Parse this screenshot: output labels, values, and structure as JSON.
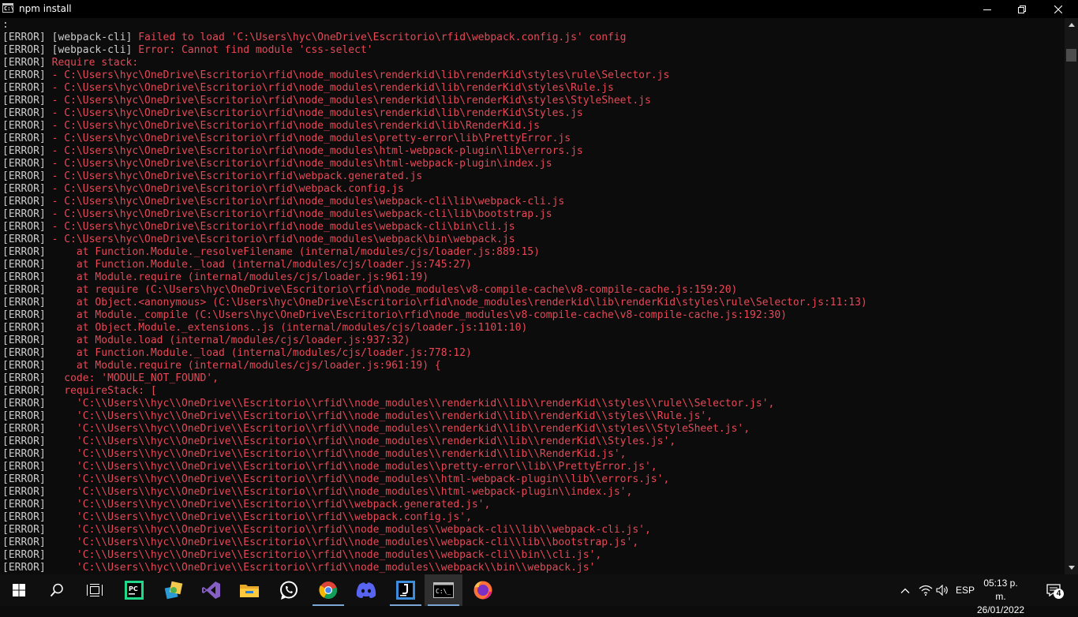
{
  "window": {
    "title": "npm install",
    "icon_label": "C:\\",
    "controls": {
      "minimize": "minimize-icon",
      "maximize": "restore-icon",
      "close": "close-icon"
    }
  },
  "console": {
    "colors": {
      "background": "#0c0c0c",
      "text": "#cccccc",
      "error": "#e74856"
    },
    "lines": [
      {
        "tag": "",
        "src": "",
        "msg": ":"
      },
      {
        "tag": "[ERROR]",
        "src": " [webpack-cli] ",
        "msg": "Failed to load 'C:\\Users\\hyc\\OneDrive\\Escritorio\\rfid\\webpack.config.js' config"
      },
      {
        "tag": "[ERROR]",
        "src": " [webpack-cli] ",
        "msg": "Error: Cannot find module 'css-select'"
      },
      {
        "tag": "[ERROR]",
        "src": " ",
        "msg": "Require stack:"
      },
      {
        "tag": "[ERROR]",
        "src": " ",
        "msg": "- C:\\Users\\hyc\\OneDrive\\Escritorio\\rfid\\node_modules\\renderkid\\lib\\renderKid\\styles\\rule\\Selector.js"
      },
      {
        "tag": "[ERROR]",
        "src": " ",
        "msg": "- C:\\Users\\hyc\\OneDrive\\Escritorio\\rfid\\node_modules\\renderkid\\lib\\renderKid\\styles\\Rule.js"
      },
      {
        "tag": "[ERROR]",
        "src": " ",
        "msg": "- C:\\Users\\hyc\\OneDrive\\Escritorio\\rfid\\node_modules\\renderkid\\lib\\renderKid\\styles\\StyleSheet.js"
      },
      {
        "tag": "[ERROR]",
        "src": " ",
        "msg": "- C:\\Users\\hyc\\OneDrive\\Escritorio\\rfid\\node_modules\\renderkid\\lib\\renderKid\\Styles.js"
      },
      {
        "tag": "[ERROR]",
        "src": " ",
        "msg": "- C:\\Users\\hyc\\OneDrive\\Escritorio\\rfid\\node_modules\\renderkid\\lib\\RenderKid.js"
      },
      {
        "tag": "[ERROR]",
        "src": " ",
        "msg": "- C:\\Users\\hyc\\OneDrive\\Escritorio\\rfid\\node_modules\\pretty-error\\lib\\PrettyError.js"
      },
      {
        "tag": "[ERROR]",
        "src": " ",
        "msg": "- C:\\Users\\hyc\\OneDrive\\Escritorio\\rfid\\node_modules\\html-webpack-plugin\\lib\\errors.js"
      },
      {
        "tag": "[ERROR]",
        "src": " ",
        "msg": "- C:\\Users\\hyc\\OneDrive\\Escritorio\\rfid\\node_modules\\html-webpack-plugin\\index.js"
      },
      {
        "tag": "[ERROR]",
        "src": " ",
        "msg": "- C:\\Users\\hyc\\OneDrive\\Escritorio\\rfid\\webpack.generated.js"
      },
      {
        "tag": "[ERROR]",
        "src": " ",
        "msg": "- C:\\Users\\hyc\\OneDrive\\Escritorio\\rfid\\webpack.config.js"
      },
      {
        "tag": "[ERROR]",
        "src": " ",
        "msg": "- C:\\Users\\hyc\\OneDrive\\Escritorio\\rfid\\node_modules\\webpack-cli\\lib\\webpack-cli.js"
      },
      {
        "tag": "[ERROR]",
        "src": " ",
        "msg": "- C:\\Users\\hyc\\OneDrive\\Escritorio\\rfid\\node_modules\\webpack-cli\\lib\\bootstrap.js"
      },
      {
        "tag": "[ERROR]",
        "src": " ",
        "msg": "- C:\\Users\\hyc\\OneDrive\\Escritorio\\rfid\\node_modules\\webpack-cli\\bin\\cli.js"
      },
      {
        "tag": "[ERROR]",
        "src": " ",
        "msg": "- C:\\Users\\hyc\\OneDrive\\Escritorio\\rfid\\node_modules\\webpack\\bin\\webpack.js"
      },
      {
        "tag": "[ERROR]",
        "src": " ",
        "msg": "    at Function.Module._resolveFilename (internal/modules/cjs/loader.js:889:15)"
      },
      {
        "tag": "[ERROR]",
        "src": " ",
        "msg": "    at Function.Module._load (internal/modules/cjs/loader.js:745:27)"
      },
      {
        "tag": "[ERROR]",
        "src": " ",
        "msg": "    at Module.require (internal/modules/cjs/loader.js:961:19)"
      },
      {
        "tag": "[ERROR]",
        "src": " ",
        "msg": "    at require (C:\\Users\\hyc\\OneDrive\\Escritorio\\rfid\\node_modules\\v8-compile-cache\\v8-compile-cache.js:159:20)"
      },
      {
        "tag": "[ERROR]",
        "src": " ",
        "msg": "    at Object.<anonymous> (C:\\Users\\hyc\\OneDrive\\Escritorio\\rfid\\node_modules\\renderkid\\lib\\renderKid\\styles\\rule\\Selector.js:11:13)"
      },
      {
        "tag": "[ERROR]",
        "src": " ",
        "msg": "    at Module._compile (C:\\Users\\hyc\\OneDrive\\Escritorio\\rfid\\node_modules\\v8-compile-cache\\v8-compile-cache.js:192:30)"
      },
      {
        "tag": "[ERROR]",
        "src": " ",
        "msg": "    at Object.Module._extensions..js (internal/modules/cjs/loader.js:1101:10)"
      },
      {
        "tag": "[ERROR]",
        "src": " ",
        "msg": "    at Module.load (internal/modules/cjs/loader.js:937:32)"
      },
      {
        "tag": "[ERROR]",
        "src": " ",
        "msg": "    at Function.Module._load (internal/modules/cjs/loader.js:778:12)"
      },
      {
        "tag": "[ERROR]",
        "src": " ",
        "msg": "    at Module.require (internal/modules/cjs/loader.js:961:19) {"
      },
      {
        "tag": "[ERROR]",
        "src": " ",
        "msg": "  code: 'MODULE_NOT_FOUND',"
      },
      {
        "tag": "[ERROR]",
        "src": " ",
        "msg": "  requireStack: ["
      },
      {
        "tag": "[ERROR]",
        "src": " ",
        "msg": "    'C:\\\\Users\\\\hyc\\\\OneDrive\\\\Escritorio\\\\rfid\\\\node_modules\\\\renderkid\\\\lib\\\\renderKid\\\\styles\\\\rule\\\\Selector.js',"
      },
      {
        "tag": "[ERROR]",
        "src": " ",
        "msg": "    'C:\\\\Users\\\\hyc\\\\OneDrive\\\\Escritorio\\\\rfid\\\\node_modules\\\\renderkid\\\\lib\\\\renderKid\\\\styles\\\\Rule.js',"
      },
      {
        "tag": "[ERROR]",
        "src": " ",
        "msg": "    'C:\\\\Users\\\\hyc\\\\OneDrive\\\\Escritorio\\\\rfid\\\\node_modules\\\\renderkid\\\\lib\\\\renderKid\\\\styles\\\\StyleSheet.js',"
      },
      {
        "tag": "[ERROR]",
        "src": " ",
        "msg": "    'C:\\\\Users\\\\hyc\\\\OneDrive\\\\Escritorio\\\\rfid\\\\node_modules\\\\renderkid\\\\lib\\\\renderKid\\\\Styles.js',"
      },
      {
        "tag": "[ERROR]",
        "src": " ",
        "msg": "    'C:\\\\Users\\\\hyc\\\\OneDrive\\\\Escritorio\\\\rfid\\\\node_modules\\\\renderkid\\\\lib\\\\RenderKid.js',"
      },
      {
        "tag": "[ERROR]",
        "src": " ",
        "msg": "    'C:\\\\Users\\\\hyc\\\\OneDrive\\\\Escritorio\\\\rfid\\\\node_modules\\\\pretty-error\\\\lib\\\\PrettyError.js',"
      },
      {
        "tag": "[ERROR]",
        "src": " ",
        "msg": "    'C:\\\\Users\\\\hyc\\\\OneDrive\\\\Escritorio\\\\rfid\\\\node_modules\\\\html-webpack-plugin\\\\lib\\\\errors.js',"
      },
      {
        "tag": "[ERROR]",
        "src": " ",
        "msg": "    'C:\\\\Users\\\\hyc\\\\OneDrive\\\\Escritorio\\\\rfid\\\\node_modules\\\\html-webpack-plugin\\\\index.js',"
      },
      {
        "tag": "[ERROR]",
        "src": " ",
        "msg": "    'C:\\\\Users\\\\hyc\\\\OneDrive\\\\Escritorio\\\\rfid\\\\webpack.generated.js',"
      },
      {
        "tag": "[ERROR]",
        "src": " ",
        "msg": "    'C:\\\\Users\\\\hyc\\\\OneDrive\\\\Escritorio\\\\rfid\\\\webpack.config.js',"
      },
      {
        "tag": "[ERROR]",
        "src": " ",
        "msg": "    'C:\\\\Users\\\\hyc\\\\OneDrive\\\\Escritorio\\\\rfid\\\\node_modules\\\\webpack-cli\\\\lib\\\\webpack-cli.js',"
      },
      {
        "tag": "[ERROR]",
        "src": " ",
        "msg": "    'C:\\\\Users\\\\hyc\\\\OneDrive\\\\Escritorio\\\\rfid\\\\node_modules\\\\webpack-cli\\\\lib\\\\bootstrap.js',"
      },
      {
        "tag": "[ERROR]",
        "src": " ",
        "msg": "    'C:\\\\Users\\\\hyc\\\\OneDrive\\\\Escritorio\\\\rfid\\\\node_modules\\\\webpack-cli\\\\bin\\\\cli.js',"
      },
      {
        "tag": "[ERROR]",
        "src": " ",
        "msg": "    'C:\\\\Users\\\\hyc\\\\OneDrive\\\\Escritorio\\\\rfid\\\\node_modules\\\\webpack\\\\bin\\\\webpack.js'"
      }
    ]
  },
  "taskbar": {
    "apps": [
      {
        "name": "start-button",
        "icon": "windows-logo-icon",
        "running": false,
        "active": false
      },
      {
        "name": "search-button",
        "icon": "search-icon",
        "running": false,
        "active": false
      },
      {
        "name": "task-view-button",
        "icon": "task-view-icon",
        "running": false,
        "active": false
      },
      {
        "name": "pycharm-app",
        "icon": "pycharm-icon",
        "running": false,
        "active": false
      },
      {
        "name": "paint-app",
        "icon": "paint-icon",
        "running": false,
        "active": false
      },
      {
        "name": "visual-studio-app",
        "icon": "visual-studio-icon",
        "running": false,
        "active": false
      },
      {
        "name": "file-explorer-app",
        "icon": "folder-icon",
        "running": false,
        "active": false
      },
      {
        "name": "whatsapp-app",
        "icon": "whatsapp-icon",
        "running": false,
        "active": false
      },
      {
        "name": "chrome-app",
        "icon": "chrome-icon",
        "running": true,
        "active": false
      },
      {
        "name": "discord-app",
        "icon": "discord-icon",
        "running": false,
        "active": false
      },
      {
        "name": "jetbrains-app",
        "icon": "jetbrains-icon",
        "running": true,
        "active": false
      },
      {
        "name": "terminal-app",
        "icon": "terminal-icon",
        "running": true,
        "active": true
      },
      {
        "name": "firefox-app",
        "icon": "firefox-icon",
        "running": false,
        "active": false
      }
    ],
    "tray": {
      "language": "ESP",
      "time": "05:13 p. m.",
      "date": "26/01/2022",
      "notification_count": "4"
    }
  }
}
